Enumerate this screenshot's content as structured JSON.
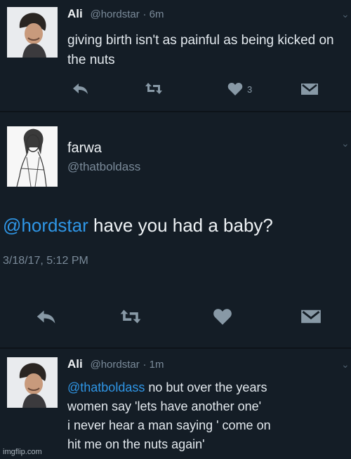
{
  "tweet1": {
    "name": "Ali",
    "handle": "@hordstar",
    "time": "· 6m",
    "text": "giving birth isn't as painful as being kicked on the nuts",
    "likes": "3"
  },
  "tweet2": {
    "name": "farwa",
    "handle": "@thatboldass",
    "mention": "@hordstar",
    "text": " have you had a baby?",
    "timestamp": "3/18/17, 5:12 PM"
  },
  "tweet3": {
    "name": "Ali",
    "handle": "@hordstar",
    "time": "· 1m",
    "mention": "@thatboldass",
    "text_line1": " no but over the years",
    "text_line2": "women say 'lets have another one'",
    "text_line3": "i never hear a man saying ' come on",
    "text_line4": "hit me on the nuts again'"
  },
  "watermark": "imgflip.com",
  "icons": [
    "reply-icon",
    "retweet-icon",
    "like-icon",
    "dm-icon",
    "chevron-down-icon"
  ],
  "colors": {
    "background": "#141d26",
    "mention": "#2f96e6",
    "muted": "#8899a6"
  }
}
